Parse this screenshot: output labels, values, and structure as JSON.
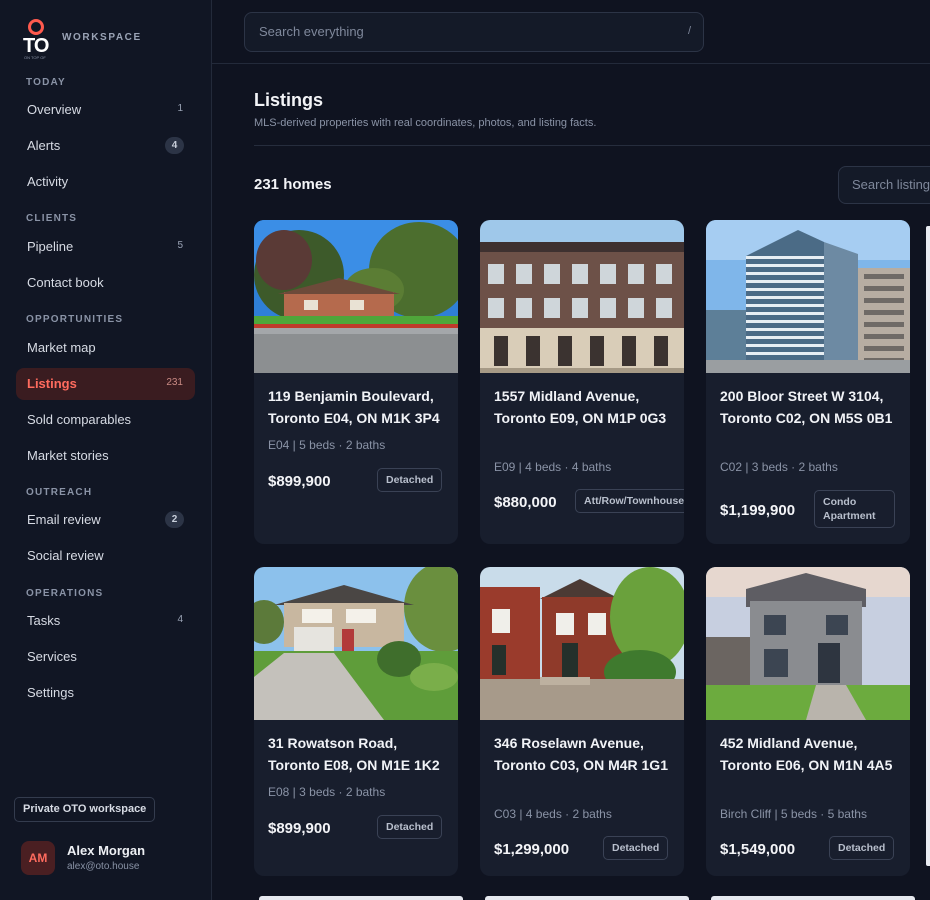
{
  "brand": {
    "logo_text": "TO",
    "logo_small": "ON TOP OF",
    "tag": "WORKSPACE",
    "accent": "#ff5a4e"
  },
  "topbar": {
    "search_placeholder": "Search everything",
    "search_shortcut": "/"
  },
  "sidebar": {
    "sections": [
      {
        "label": "TODAY",
        "items": [
          {
            "label": "Overview",
            "count": "1",
            "style": "plain"
          },
          {
            "label": "Alerts",
            "count": "4",
            "style": "pill"
          },
          {
            "label": "Activity",
            "count": "",
            "style": "plain"
          }
        ]
      },
      {
        "label": "CLIENTS",
        "items": [
          {
            "label": "Pipeline",
            "count": "5",
            "style": "plain"
          },
          {
            "label": "Contact book",
            "count": "",
            "style": "plain"
          }
        ]
      },
      {
        "label": "OPPORTUNITIES",
        "items": [
          {
            "label": "Market map",
            "count": "",
            "style": "plain"
          },
          {
            "label": "Listings",
            "count": "231",
            "style": "plain",
            "active": true
          },
          {
            "label": "Sold comparables",
            "count": "",
            "style": "plain"
          },
          {
            "label": "Market stories",
            "count": "",
            "style": "plain"
          }
        ]
      },
      {
        "label": "OUTREACH",
        "items": [
          {
            "label": "Email review",
            "count": "2",
            "style": "pill"
          },
          {
            "label": "Social review",
            "count": "",
            "style": "plain"
          }
        ]
      },
      {
        "label": "OPERATIONS",
        "items": [
          {
            "label": "Tasks",
            "count": "4",
            "style": "plain"
          },
          {
            "label": "Services",
            "count": "",
            "style": "plain"
          },
          {
            "label": "Settings",
            "count": "",
            "style": "plain"
          }
        ]
      }
    ],
    "workspace_badge": "Private OTO workspace",
    "user": {
      "initials": "AM",
      "name": "Alex Morgan",
      "email": "alex@oto.house"
    }
  },
  "main": {
    "title": "Listings",
    "subtitle": "MLS-derived properties with real coordinates, photos, and listing facts.",
    "count_label": "231 homes",
    "search_placeholder": "Search listings"
  },
  "listings": [
    {
      "address": "119 Benjamin Boulevard, Toronto E04, ON M1K 3P4",
      "meta": "E04 | 5 beds · 2 baths",
      "price": "$899,900",
      "type": "Detached",
      "photo": "bungalow-with-trees"
    },
    {
      "address": "1557 Midland Avenue, Toronto E09, ON M1P 0G3",
      "meta": "E09 | 4 beds · 4 baths",
      "price": "$880,000",
      "type": "Att/Row/Townhouse",
      "photo": "brick-townhouses"
    },
    {
      "address": "200 Bloor Street W 3104, Toronto C02, ON M5S 0B1",
      "meta": "C02 | 3 beds · 2 baths",
      "price": "$1,199,900",
      "type": "Condo Apartment",
      "photo": "glass-condo-tower"
    },
    {
      "address": "31 Rowatson Road, Toronto E08, ON M1E 1K2",
      "meta": "E08 | 3 beds · 2 baths",
      "price": "$899,900",
      "type": "Detached",
      "photo": "sidesplit-house-garage"
    },
    {
      "address": "346 Roselawn Avenue, Toronto C03, ON M4R 1G1",
      "meta": "C03 | 4 beds · 2 baths",
      "price": "$1,299,000",
      "type": "Detached",
      "photo": "red-brick-semi"
    },
    {
      "address": "452 Midland Avenue, Toronto E06, ON M1N 4A5",
      "meta": "Birch Cliff | 5 beds · 5 baths",
      "price": "$1,549,000",
      "type": "Detached",
      "photo": "new-stone-two-storey"
    }
  ]
}
